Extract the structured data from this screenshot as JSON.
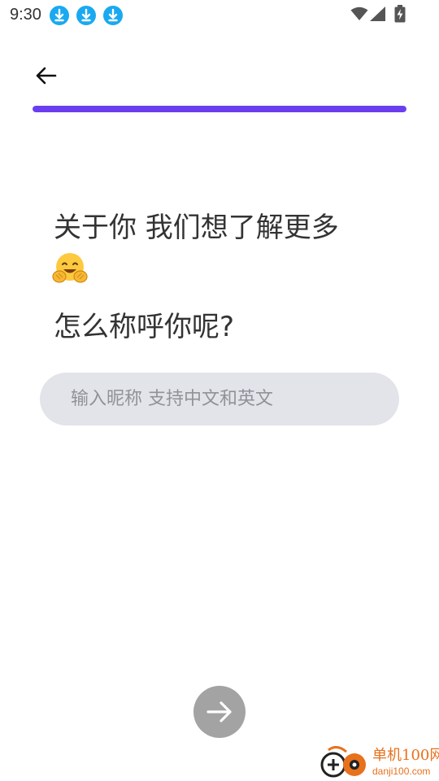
{
  "status_bar": {
    "time": "9:30",
    "notification_icons": [
      "download-icon",
      "download-icon",
      "download-icon"
    ],
    "right_icons": [
      "wifi-icon",
      "signal-icon",
      "battery-charging-icon"
    ]
  },
  "header": {
    "back_icon": "arrow-left-icon"
  },
  "progress": {
    "fraction": 1.0,
    "color": "#6a3ef0"
  },
  "content": {
    "intro": "关于你 我们想了解更多",
    "emoji_name": "hugging-face-emoji",
    "question": "怎么称呼你呢?"
  },
  "nickname_input": {
    "value": "",
    "placeholder": "输入昵称 支持中文和英文"
  },
  "next_button": {
    "icon": "arrow-right-icon",
    "background": "#a3a3a3"
  },
  "watermark": {
    "name": "单机100网",
    "url": "danji100.com"
  }
}
